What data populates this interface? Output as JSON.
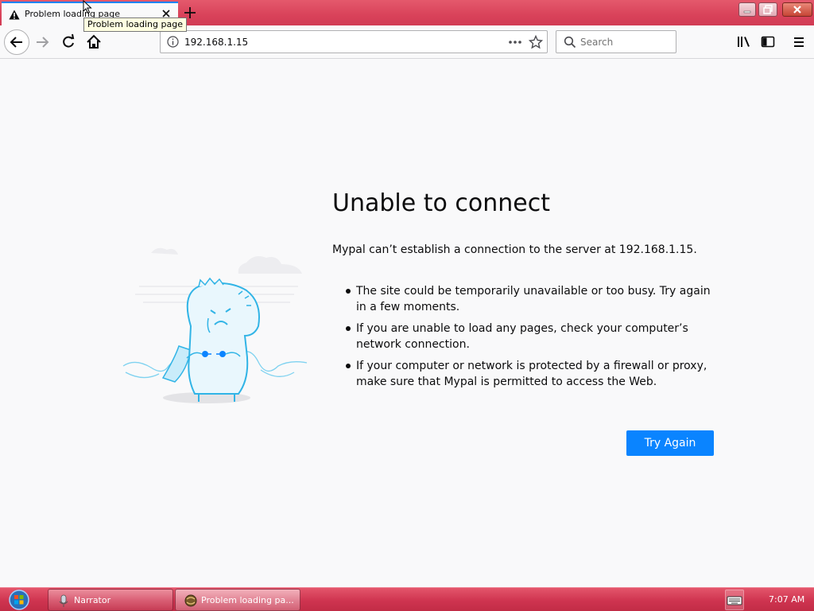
{
  "tab": {
    "title": "Problem loading page",
    "tooltip": "Problem loading page"
  },
  "navbar": {
    "url": "192.168.1.15",
    "search_placeholder": "Search"
  },
  "error": {
    "title": "Unable to connect",
    "description": "Mypal can’t establish a connection to the server at 192.168.1.15.",
    "items": [
      "The site could be temporarily unavailable or too busy. Try again in a few moments.",
      "If you are unable to load any pages, check your computer’s network connection.",
      "If your computer or network is protected by a firewall or proxy, make sure that Mypal is permitted to access the Web."
    ],
    "button_label": "Try Again"
  },
  "taskbar": {
    "items": [
      {
        "label": "Narrator"
      },
      {
        "label": "Problem loading pa..."
      }
    ],
    "clock": "7:07 AM"
  },
  "colors": {
    "accent": "#0a84ff",
    "titlebar": "#d9425a",
    "taskbar": "#cf3450"
  },
  "icons": [
    "warning-icon",
    "close-icon",
    "plus-icon",
    "back-icon",
    "forward-icon",
    "reload-icon",
    "home-icon",
    "info-icon",
    "more-icon",
    "star-icon",
    "search-icon",
    "library-icon",
    "sidebar-icon",
    "menu-icon",
    "start-orb-icon",
    "keyboard-icon"
  ]
}
